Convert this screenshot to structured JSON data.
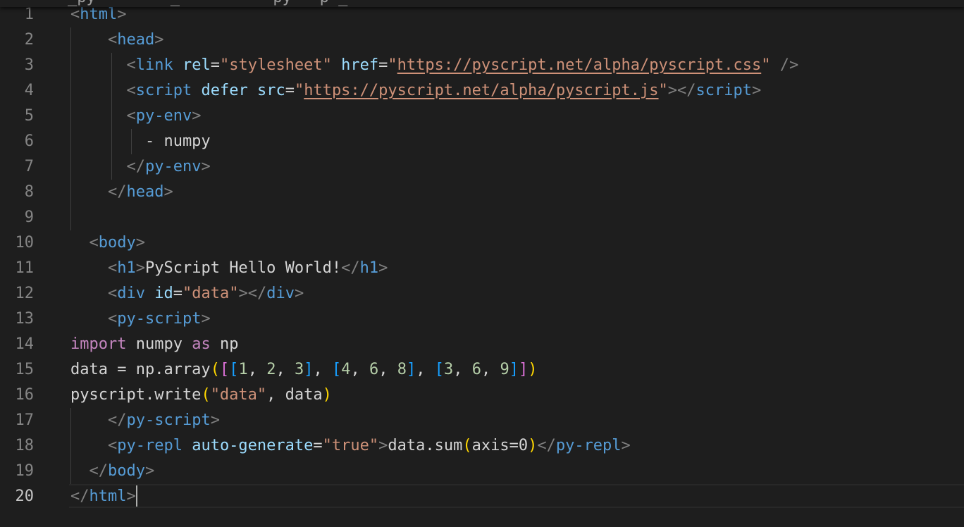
{
  "editor": {
    "partial_tab_title": "_py        _          py   p _",
    "active_line": 20,
    "lines": [
      {
        "num": "1",
        "tokens": [
          [
            "p",
            "<"
          ],
          [
            "tag",
            "html"
          ],
          [
            "p",
            ">"
          ]
        ]
      },
      {
        "num": "2",
        "tokens": [
          [
            "x",
            "    "
          ],
          [
            "p",
            "<"
          ],
          [
            "tag",
            "head"
          ],
          [
            "p",
            ">"
          ]
        ]
      },
      {
        "num": "3",
        "tokens": [
          [
            "x",
            "      "
          ],
          [
            "p",
            "<"
          ],
          [
            "tag",
            "link"
          ],
          [
            "x",
            " "
          ],
          [
            "attr",
            "rel"
          ],
          [
            "x",
            "="
          ],
          [
            "str",
            "\"stylesheet\""
          ],
          [
            "x",
            " "
          ],
          [
            "attr",
            "href"
          ],
          [
            "x",
            "="
          ],
          [
            "str",
            "\""
          ],
          [
            "link",
            "https://pyscript.net/alpha/pyscript.css"
          ],
          [
            "str",
            "\""
          ],
          [
            "x",
            " "
          ],
          [
            "p",
            "/>"
          ]
        ]
      },
      {
        "num": "4",
        "tokens": [
          [
            "x",
            "      "
          ],
          [
            "p",
            "<"
          ],
          [
            "tag",
            "script"
          ],
          [
            "x",
            " "
          ],
          [
            "attr",
            "defer"
          ],
          [
            "x",
            " "
          ],
          [
            "attr",
            "src"
          ],
          [
            "x",
            "="
          ],
          [
            "str",
            "\""
          ],
          [
            "link",
            "https://pyscript.net/alpha/pyscript.js"
          ],
          [
            "str",
            "\""
          ],
          [
            "p",
            "></"
          ],
          [
            "tag",
            "script"
          ],
          [
            "p",
            ">"
          ]
        ]
      },
      {
        "num": "5",
        "tokens": [
          [
            "x",
            "      "
          ],
          [
            "p",
            "<"
          ],
          [
            "tag",
            "py-env"
          ],
          [
            "p",
            ">"
          ]
        ]
      },
      {
        "num": "6",
        "tokens": [
          [
            "x",
            "        - numpy"
          ]
        ]
      },
      {
        "num": "7",
        "tokens": [
          [
            "x",
            "      "
          ],
          [
            "p",
            "</"
          ],
          [
            "tag",
            "py-env"
          ],
          [
            "p",
            ">"
          ]
        ]
      },
      {
        "num": "8",
        "tokens": [
          [
            "x",
            "    "
          ],
          [
            "p",
            "</"
          ],
          [
            "tag",
            "head"
          ],
          [
            "p",
            ">"
          ]
        ]
      },
      {
        "num": "9",
        "tokens": []
      },
      {
        "num": "10",
        "tokens": [
          [
            "x",
            "  "
          ],
          [
            "p",
            "<"
          ],
          [
            "tag",
            "body"
          ],
          [
            "p",
            ">"
          ]
        ]
      },
      {
        "num": "11",
        "tokens": [
          [
            "x",
            "    "
          ],
          [
            "p",
            "<"
          ],
          [
            "tag",
            "h1"
          ],
          [
            "p",
            ">"
          ],
          [
            "x",
            "PyScript Hello World!"
          ],
          [
            "p",
            "</"
          ],
          [
            "tag",
            "h1"
          ],
          [
            "p",
            ">"
          ]
        ]
      },
      {
        "num": "12",
        "tokens": [
          [
            "x",
            "    "
          ],
          [
            "p",
            "<"
          ],
          [
            "tag",
            "div"
          ],
          [
            "x",
            " "
          ],
          [
            "attr",
            "id"
          ],
          [
            "x",
            "="
          ],
          [
            "str",
            "\"data\""
          ],
          [
            "p",
            "></"
          ],
          [
            "tag",
            "div"
          ],
          [
            "p",
            ">"
          ]
        ]
      },
      {
        "num": "13",
        "tokens": [
          [
            "x",
            "    "
          ],
          [
            "p",
            "<"
          ],
          [
            "tag",
            "py-script"
          ],
          [
            "p",
            ">"
          ]
        ]
      },
      {
        "num": "14",
        "tokens": [
          [
            "kw",
            "import"
          ],
          [
            "x",
            " numpy "
          ],
          [
            "kw",
            "as"
          ],
          [
            "x",
            " np"
          ]
        ]
      },
      {
        "num": "15",
        "tokens": [
          [
            "x",
            "data = np.array"
          ],
          [
            "b1",
            "("
          ],
          [
            "b2",
            "["
          ],
          [
            "b3",
            "["
          ],
          [
            "num",
            "1"
          ],
          [
            "x",
            ", "
          ],
          [
            "num",
            "2"
          ],
          [
            "x",
            ", "
          ],
          [
            "num",
            "3"
          ],
          [
            "b3",
            "]"
          ],
          [
            "x",
            ", "
          ],
          [
            "b3",
            "["
          ],
          [
            "num",
            "4"
          ],
          [
            "x",
            ", "
          ],
          [
            "num",
            "6"
          ],
          [
            "x",
            ", "
          ],
          [
            "num",
            "8"
          ],
          [
            "b3",
            "]"
          ],
          [
            "x",
            ", "
          ],
          [
            "b3",
            "["
          ],
          [
            "num",
            "3"
          ],
          [
            "x",
            ", "
          ],
          [
            "num",
            "6"
          ],
          [
            "x",
            ", "
          ],
          [
            "num",
            "9"
          ],
          [
            "b3",
            "]"
          ],
          [
            "b2",
            "]"
          ],
          [
            "b1",
            ")"
          ]
        ]
      },
      {
        "num": "16",
        "tokens": [
          [
            "x",
            "pyscript.write"
          ],
          [
            "b1",
            "("
          ],
          [
            "str",
            "\"data\""
          ],
          [
            "x",
            ", data"
          ],
          [
            "b1",
            ")"
          ]
        ]
      },
      {
        "num": "17",
        "tokens": [
          [
            "x",
            "    "
          ],
          [
            "p",
            "</"
          ],
          [
            "tag",
            "py-script"
          ],
          [
            "p",
            ">"
          ]
        ]
      },
      {
        "num": "18",
        "tokens": [
          [
            "x",
            "    "
          ],
          [
            "p",
            "<"
          ],
          [
            "tag",
            "py-repl"
          ],
          [
            "x",
            " "
          ],
          [
            "attr",
            "auto-generate"
          ],
          [
            "x",
            "="
          ],
          [
            "str",
            "\"true\""
          ],
          [
            "p",
            ">"
          ],
          [
            "x",
            "data.sum"
          ],
          [
            "b1",
            "("
          ],
          [
            "x",
            "axis=0"
          ],
          [
            "b1",
            ")"
          ],
          [
            "p",
            "</"
          ],
          [
            "tag",
            "py-repl"
          ],
          [
            "p",
            ">"
          ]
        ]
      },
      {
        "num": "19",
        "tokens": [
          [
            "x",
            "  "
          ],
          [
            "p",
            "</"
          ],
          [
            "tag",
            "body"
          ],
          [
            "p",
            ">"
          ]
        ]
      },
      {
        "num": "20",
        "tokens": [
          [
            "p",
            "</"
          ],
          [
            "tag",
            "html"
          ],
          [
            "p",
            ">"
          ]
        ]
      }
    ]
  }
}
